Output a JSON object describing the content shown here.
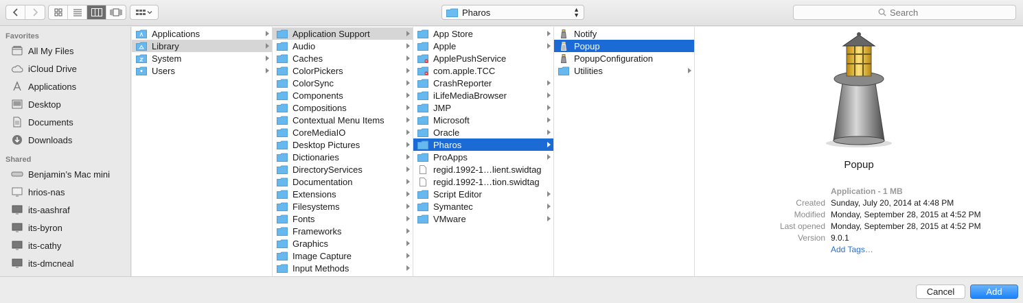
{
  "toolbar": {
    "path_label": "Pharos",
    "search_placeholder": "Search"
  },
  "sidebar": {
    "favorites_label": "Favorites",
    "favorites": [
      {
        "label": "All My Files",
        "icon": "all-files-icon"
      },
      {
        "label": "iCloud Drive",
        "icon": "cloud-icon"
      },
      {
        "label": "Applications",
        "icon": "applications-icon"
      },
      {
        "label": "Desktop",
        "icon": "desktop-icon"
      },
      {
        "label": "Documents",
        "icon": "documents-icon"
      },
      {
        "label": "Downloads",
        "icon": "downloads-icon"
      }
    ],
    "shared_label": "Shared",
    "shared": [
      {
        "label": "Benjamin’s Mac mini",
        "icon": "mac-mini-icon"
      },
      {
        "label": "hrios-nas",
        "icon": "monitor-icon"
      },
      {
        "label": "its-aashraf",
        "icon": "monitor-icon"
      },
      {
        "label": "its-byron",
        "icon": "monitor-icon"
      },
      {
        "label": "its-cathy",
        "icon": "monitor-icon"
      },
      {
        "label": "its-dmcneal",
        "icon": "monitor-icon"
      }
    ]
  },
  "columns": {
    "col1": [
      "Applications",
      "Library",
      "System",
      "Users"
    ],
    "col2": [
      "Application Support",
      "Audio",
      "Caches",
      "ColorPickers",
      "ColorSync",
      "Components",
      "Compositions",
      "Contextual Menu Items",
      "CoreMediaIO",
      "Desktop Pictures",
      "Dictionaries",
      "DirectoryServices",
      "Documentation",
      "Extensions",
      "Filesystems",
      "Fonts",
      "Frameworks",
      "Graphics",
      "Image Capture",
      "Input Methods"
    ],
    "col3": [
      "App Store",
      "Apple",
      "ApplePushService",
      "com.apple.TCC",
      "CrashReporter",
      "iLifeMediaBrowser",
      "JMP",
      "Microsoft",
      "Oracle",
      "Pharos",
      "ProApps",
      "regid.1992-1…lient.swidtag",
      "regid.1992-1…tion.swidtag",
      "Script Editor",
      "Symantec",
      "VMware"
    ],
    "col4": [
      "Notify",
      "Popup",
      "PopupConfiguration",
      "Utilities"
    ]
  },
  "preview": {
    "name": "Popup",
    "kind": "Application - 1 MB",
    "created_label": "Created",
    "created": "Sunday, July 20, 2014 at 4:48 PM",
    "modified_label": "Modified",
    "modified": "Monday, September 28, 2015 at 4:52 PM",
    "last_opened_label": "Last opened",
    "last_opened": "Monday, September 28, 2015 at 4:52 PM",
    "version_label": "Version",
    "version": "9.0.1",
    "add_tags": "Add Tags…"
  },
  "buttons": {
    "cancel": "Cancel",
    "add": "Add"
  },
  "colors": {
    "selection_blue": "#1c6ad6",
    "folder_blue": "#66b8ee",
    "link_blue": "#2a6fd6"
  }
}
